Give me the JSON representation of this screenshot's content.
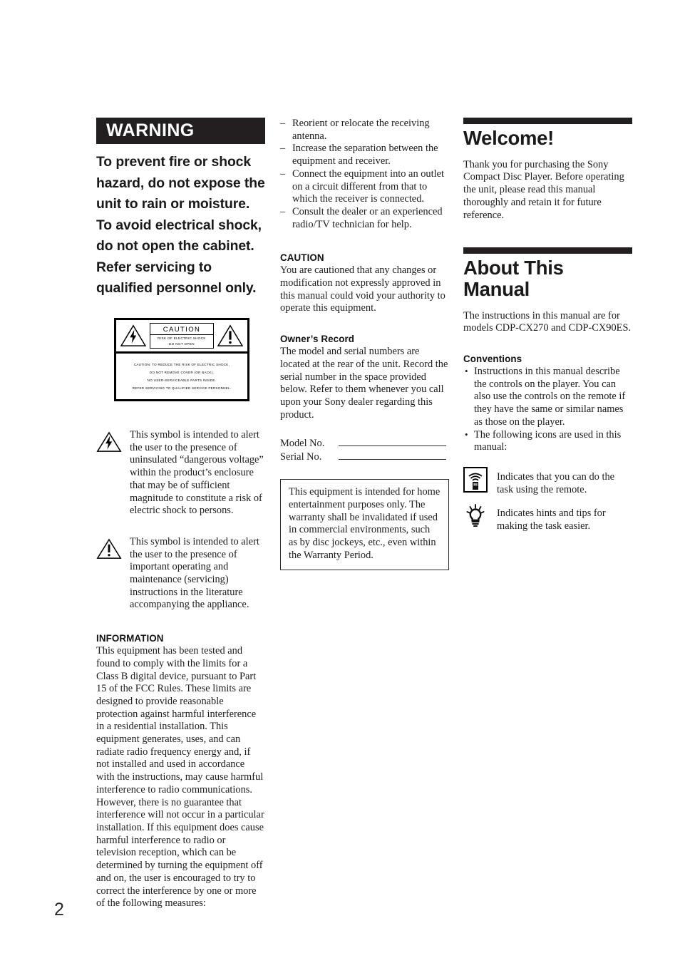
{
  "page": {
    "number": "2"
  },
  "warning": {
    "heading": "WARNING",
    "body_line_1": "To prevent fire or shock hazard, do not expose the unit to rain or moisture.",
    "body_line_2": "To avoid electrical shock, do not open the cabinet. Refer servicing to qualified personnel only."
  },
  "caution_label": {
    "title": "CAUTION",
    "subtitle_line_1": "RISK OF ELECTRIC SHOCK",
    "subtitle_line_2": "DO NOT OPEN",
    "lines": [
      "CAUTION: TO REDUCE THE RISK OF ELECTRIC SHOCK,",
      "DO NOT REMOVE COVER (OR BACK),",
      "NO USER-SERVICEABLE PARTS INSIDE.",
      "REFER SERVICING TO QUALIFIED SERVICE PERSONNEL."
    ]
  },
  "symbols": {
    "lightning": "This symbol is intended to alert the user to the presence of uninsulated “dangerous voltage” within the product’s enclosure that may be of sufficient magnitude to constitute a risk of electric shock to persons.",
    "exclamation": "This symbol is intended to alert the user to the presence of important operating and maintenance (servicing) instructions in the literature accompanying the appliance."
  },
  "information": {
    "heading": "INFORMATION",
    "body": "This equipment has been tested and found to comply with the limits for a Class B digital device, pursuant to Part 15 of the FCC Rules. These limits are designed to provide reasonable protection against harmful interference in a residential installation. This equipment generates, uses, and can radiate radio frequency energy and, if not installed and used in accordance with the instructions, may cause harmful interference to radio communications. However, there is no guarantee that interference will not occur in a particular installation. If this equipment does cause harmful interference to radio or television reception, which can be determined by turning the equipment off and on, the user is encouraged to try to correct the interference by one or more of the following measures:"
  },
  "measures": [
    "Reorient or relocate the receiving antenna.",
    "Increase the separation between the equipment and receiver.",
    "Connect the equipment into an outlet on a circuit different from that to which the receiver is connected.",
    "Consult the dealer or an experienced radio/TV technician for help."
  ],
  "caution_section": {
    "heading": "CAUTION",
    "body": "You are cautioned that any changes or modification not expressly approved in this manual could void your authority to operate this equipment."
  },
  "owners_record": {
    "heading": "Owner’s Record",
    "body": "The model and serial numbers are located at the rear of the unit. Record the serial number in the space provided below. Refer to them whenever you call upon your Sony dealer regarding this product.",
    "model_label": "Model No.",
    "model_value": "",
    "serial_label": "Serial No.",
    "serial_value": ""
  },
  "warranty_box": {
    "body": "This equipment is intended for home entertainment purposes only. The warranty shall be invalidated if used in commercial environments, such as by disc jockeys, etc., even within the Warranty Period."
  },
  "welcome": {
    "heading": "Welcome!",
    "body": "Thank you for purchasing the Sony Compact Disc Player. Before operating the unit, please read this manual thoroughly and retain it for future reference."
  },
  "about_manual": {
    "heading": "About This Manual",
    "body": "The instructions in this manual are for models CDP-CX270 and CDP-CX90ES.",
    "conventions_heading": "Conventions",
    "conventions": [
      "Instructions in this manual describe the controls on the player. You can also use the controls on the remote if they have the same or similar names as those on the player.",
      "The following icons are used in this manual:"
    ]
  },
  "icon_legend": [
    {
      "icon": "remote-control-icon",
      "text": "Indicates that you can do the task using the remote."
    },
    {
      "icon": "light-bulb-tip-icon",
      "text": "Indicates hints and tips for making the task easier."
    }
  ],
  "colors": {
    "ink": "#231f20",
    "paper": "#ffffff"
  }
}
